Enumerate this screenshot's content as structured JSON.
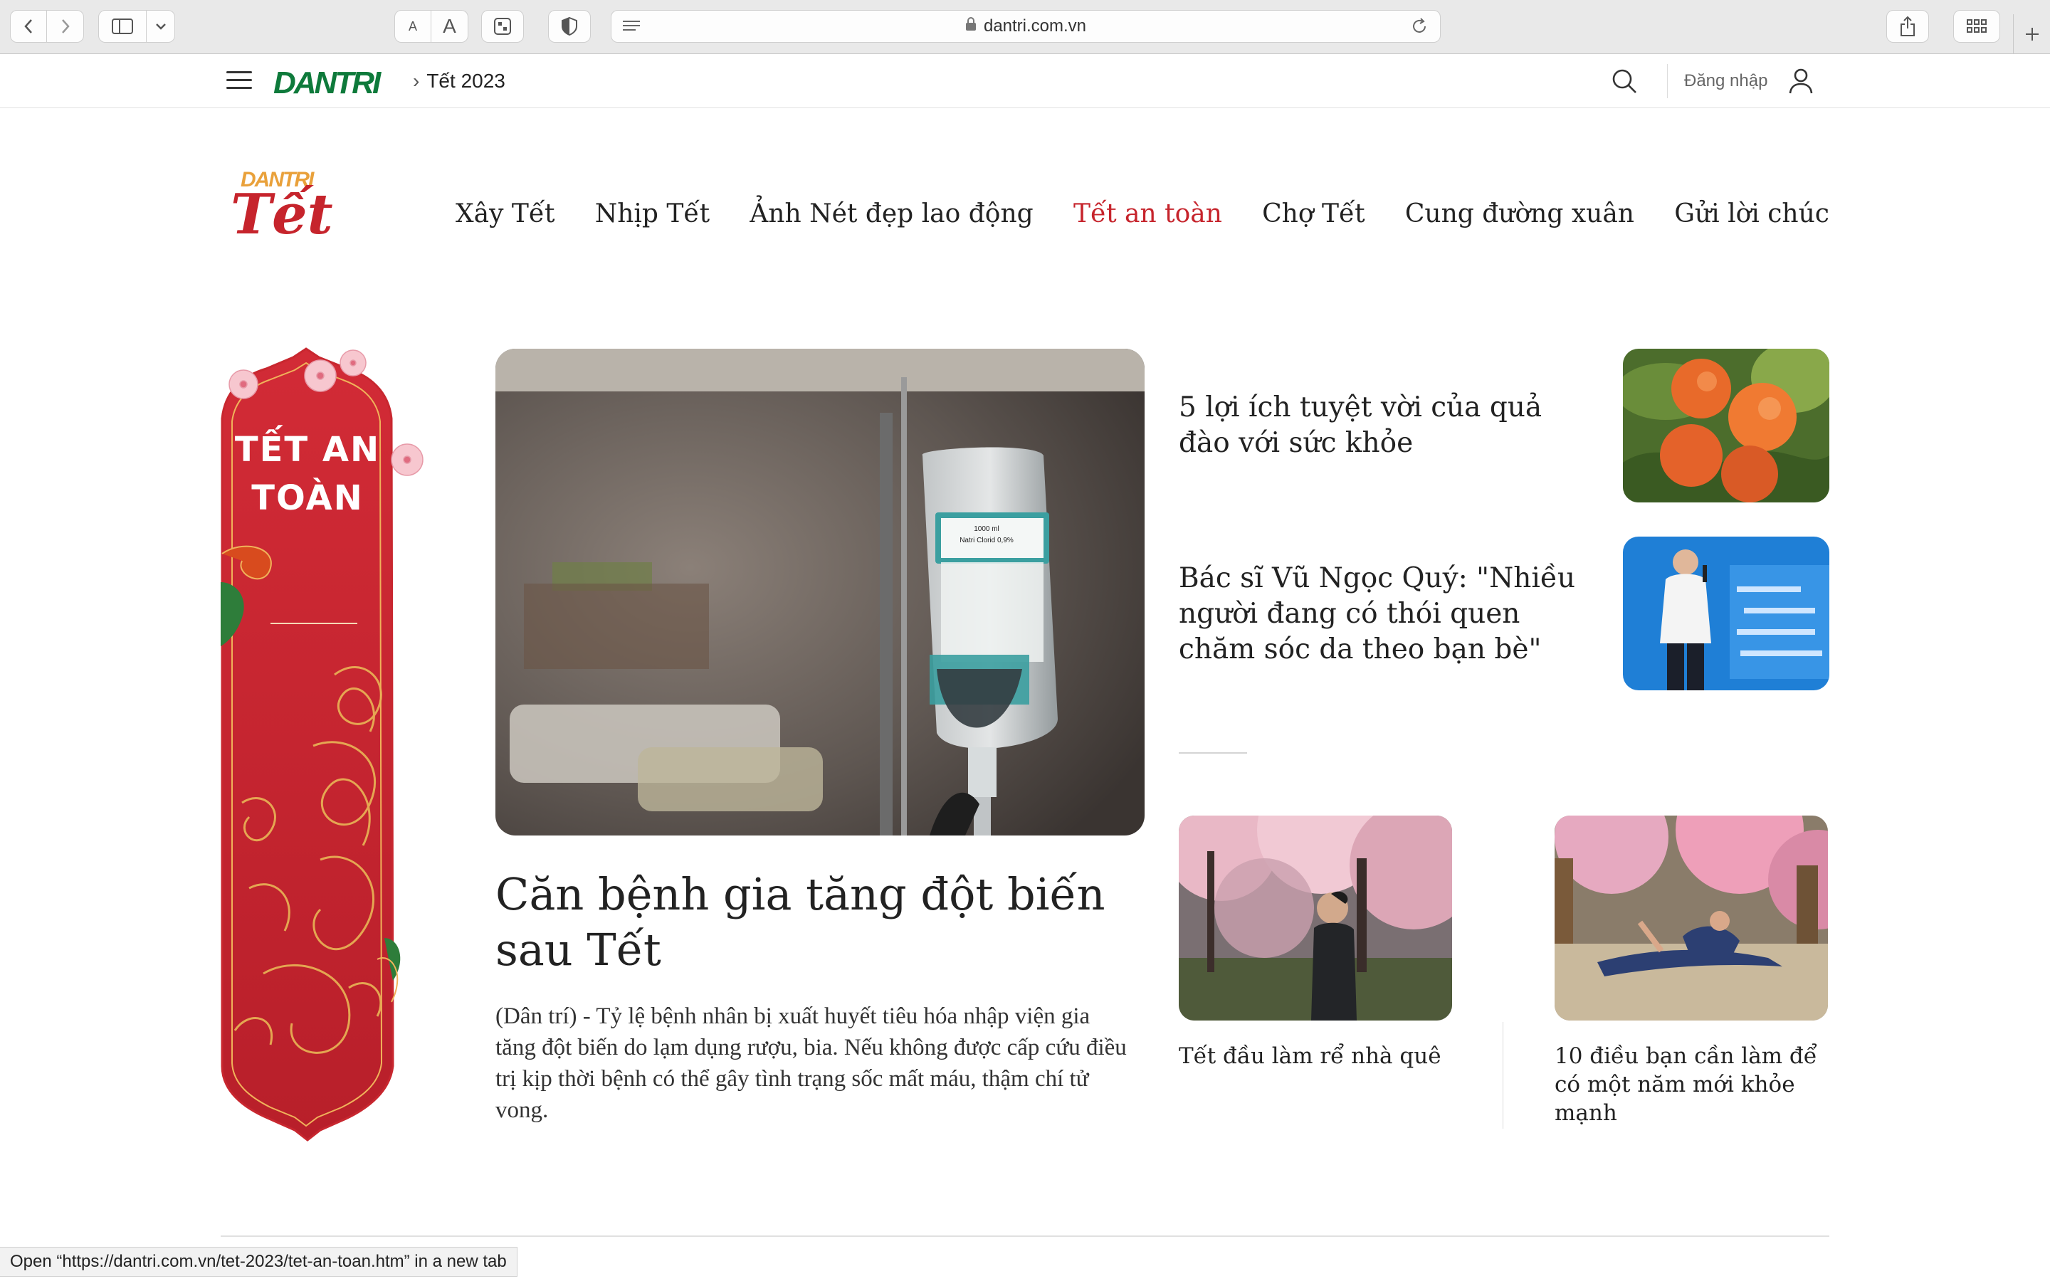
{
  "browser": {
    "url": "dantri.com.vn",
    "font_small_label": "A",
    "font_large_label": "A"
  },
  "site": {
    "logo_text": "DANTRI",
    "breadcrumb": "Tết 2023",
    "login_label": "Đăng nhập"
  },
  "tet_logo": {
    "small_text": "DANTRI",
    "big_text": "Tết"
  },
  "nav": [
    {
      "label": "Xây Tết"
    },
    {
      "label": "Nhịp Tết"
    },
    {
      "label": "Ảnh Nét đẹp lao động"
    },
    {
      "label": "Tết an toàn",
      "active": true
    },
    {
      "label": "Chợ Tết"
    },
    {
      "label": "Cung đường xuân"
    },
    {
      "label": "Gửi lời chúc"
    }
  ],
  "banner": {
    "title_line1": "TẾT AN",
    "title_line2": "TOÀN"
  },
  "featured": {
    "title": "Căn bệnh gia tăng đột biến sau Tết",
    "sapo": "(Dân trí) - Tỷ lệ bệnh nhân bị xuất huyết tiêu hóa nhập viện gia tăng đột biến do lạm dụng rượu, bia. Nếu không được cấp cứu điều trị kịp thời bệnh có thể gây tình trạng sốc mất máu, thậm chí tử vong.",
    "image_labels": {
      "bag_top": "1000 ml",
      "bag_name": "Natri Clorid 0,9%"
    }
  },
  "side_articles": [
    {
      "title": "5 lợi ích tuyệt vời của quả đào với sức khỏe"
    },
    {
      "title": "Bác sĩ Vũ Ngọc Quý: \"Nhiều người đang có thói quen chăm sóc da theo bạn bè\""
    }
  ],
  "cards": [
    {
      "title": "Tết đầu làm rể nhà quê"
    },
    {
      "title": "10 điều bạn cần làm để có một năm mới khỏe mạnh"
    }
  ],
  "status_bar": "Open “https://dantri.com.vn/tet-2023/tet-an-toan.htm” in a new tab",
  "colors": {
    "brand_green": "#0e7a3b",
    "tet_red": "#c6242c",
    "accent_gold": "#e9a13b"
  }
}
